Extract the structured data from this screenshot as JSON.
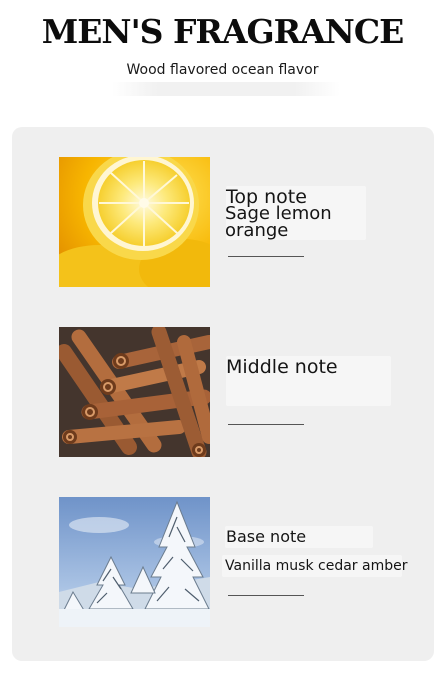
{
  "header": {
    "title": "MEN'S FRAGRANCE",
    "subtitle": "Wood flavored ocean flavor"
  },
  "notes": [
    {
      "label": "Top note",
      "value_line1": "Sage lemon",
      "value_line2": "orange",
      "image": "lemon-slices-image"
    },
    {
      "label": "Middle note",
      "image": "cinnamon-sticks-image"
    },
    {
      "label": "Base note",
      "value": "Vanilla musk cedar amber",
      "image": "snowy-pine-trees-image"
    }
  ],
  "colors": {
    "background": "#ffffff",
    "card": "#efefef",
    "text": "#111111",
    "rule": "#555555"
  }
}
